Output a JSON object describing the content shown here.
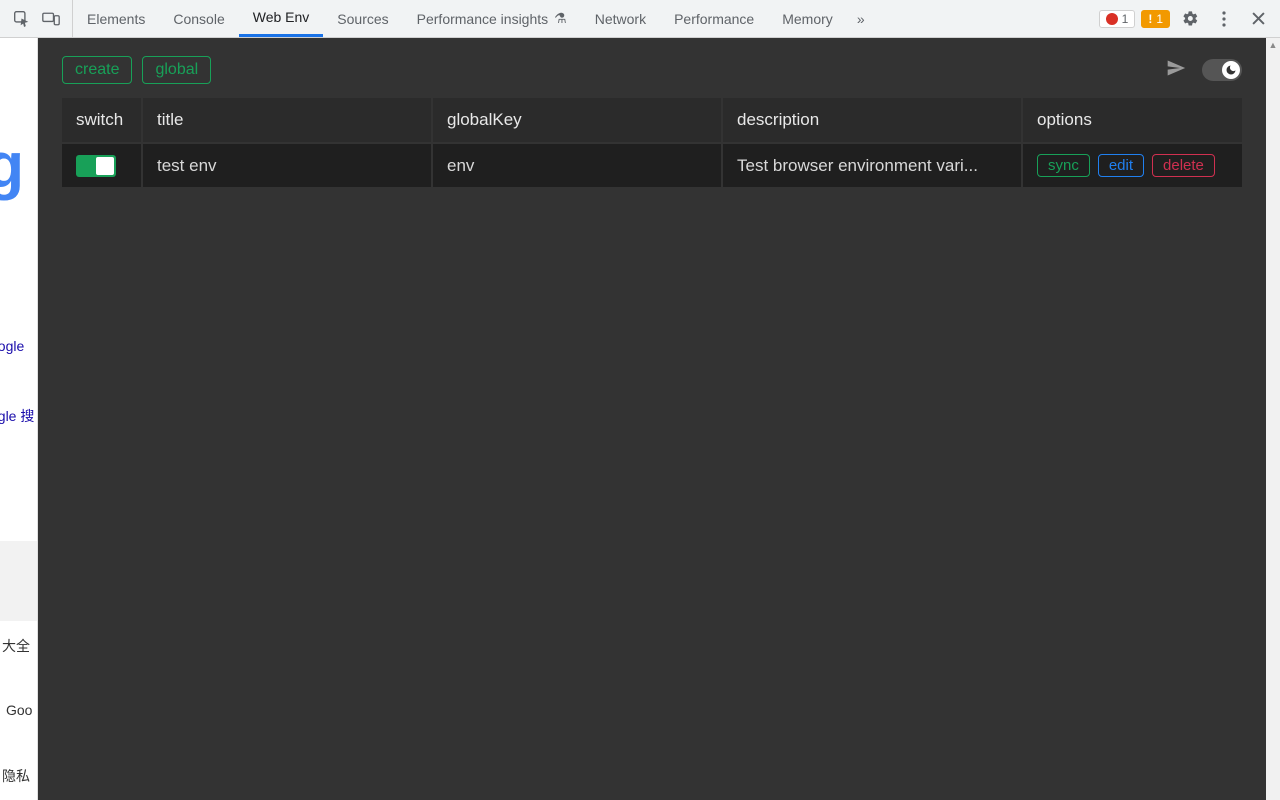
{
  "devtools": {
    "tabs": [
      "Elements",
      "Console",
      "Web Env",
      "Sources",
      "Performance insights",
      "Network",
      "Performance",
      "Memory"
    ],
    "active_tab": "Web Env",
    "insights_beaker": "▲",
    "error_count": "1",
    "warning_count": "1"
  },
  "sliver": {
    "link1": "oogle",
    "link2": "ogle 搜",
    "link3": "大全",
    "link4": "Goo",
    "link5": "隐私"
  },
  "toolbar": {
    "create_label": "create",
    "global_label": "global"
  },
  "table": {
    "headers": {
      "switch": "switch",
      "title": "title",
      "globalKey": "globalKey",
      "description": "description",
      "options": "options"
    },
    "rows": [
      {
        "switch_on": true,
        "title": "test env",
        "globalKey": "env",
        "description": "Test browser environment vari...",
        "sync": "sync",
        "edit": "edit",
        "delete": "delete"
      }
    ]
  }
}
